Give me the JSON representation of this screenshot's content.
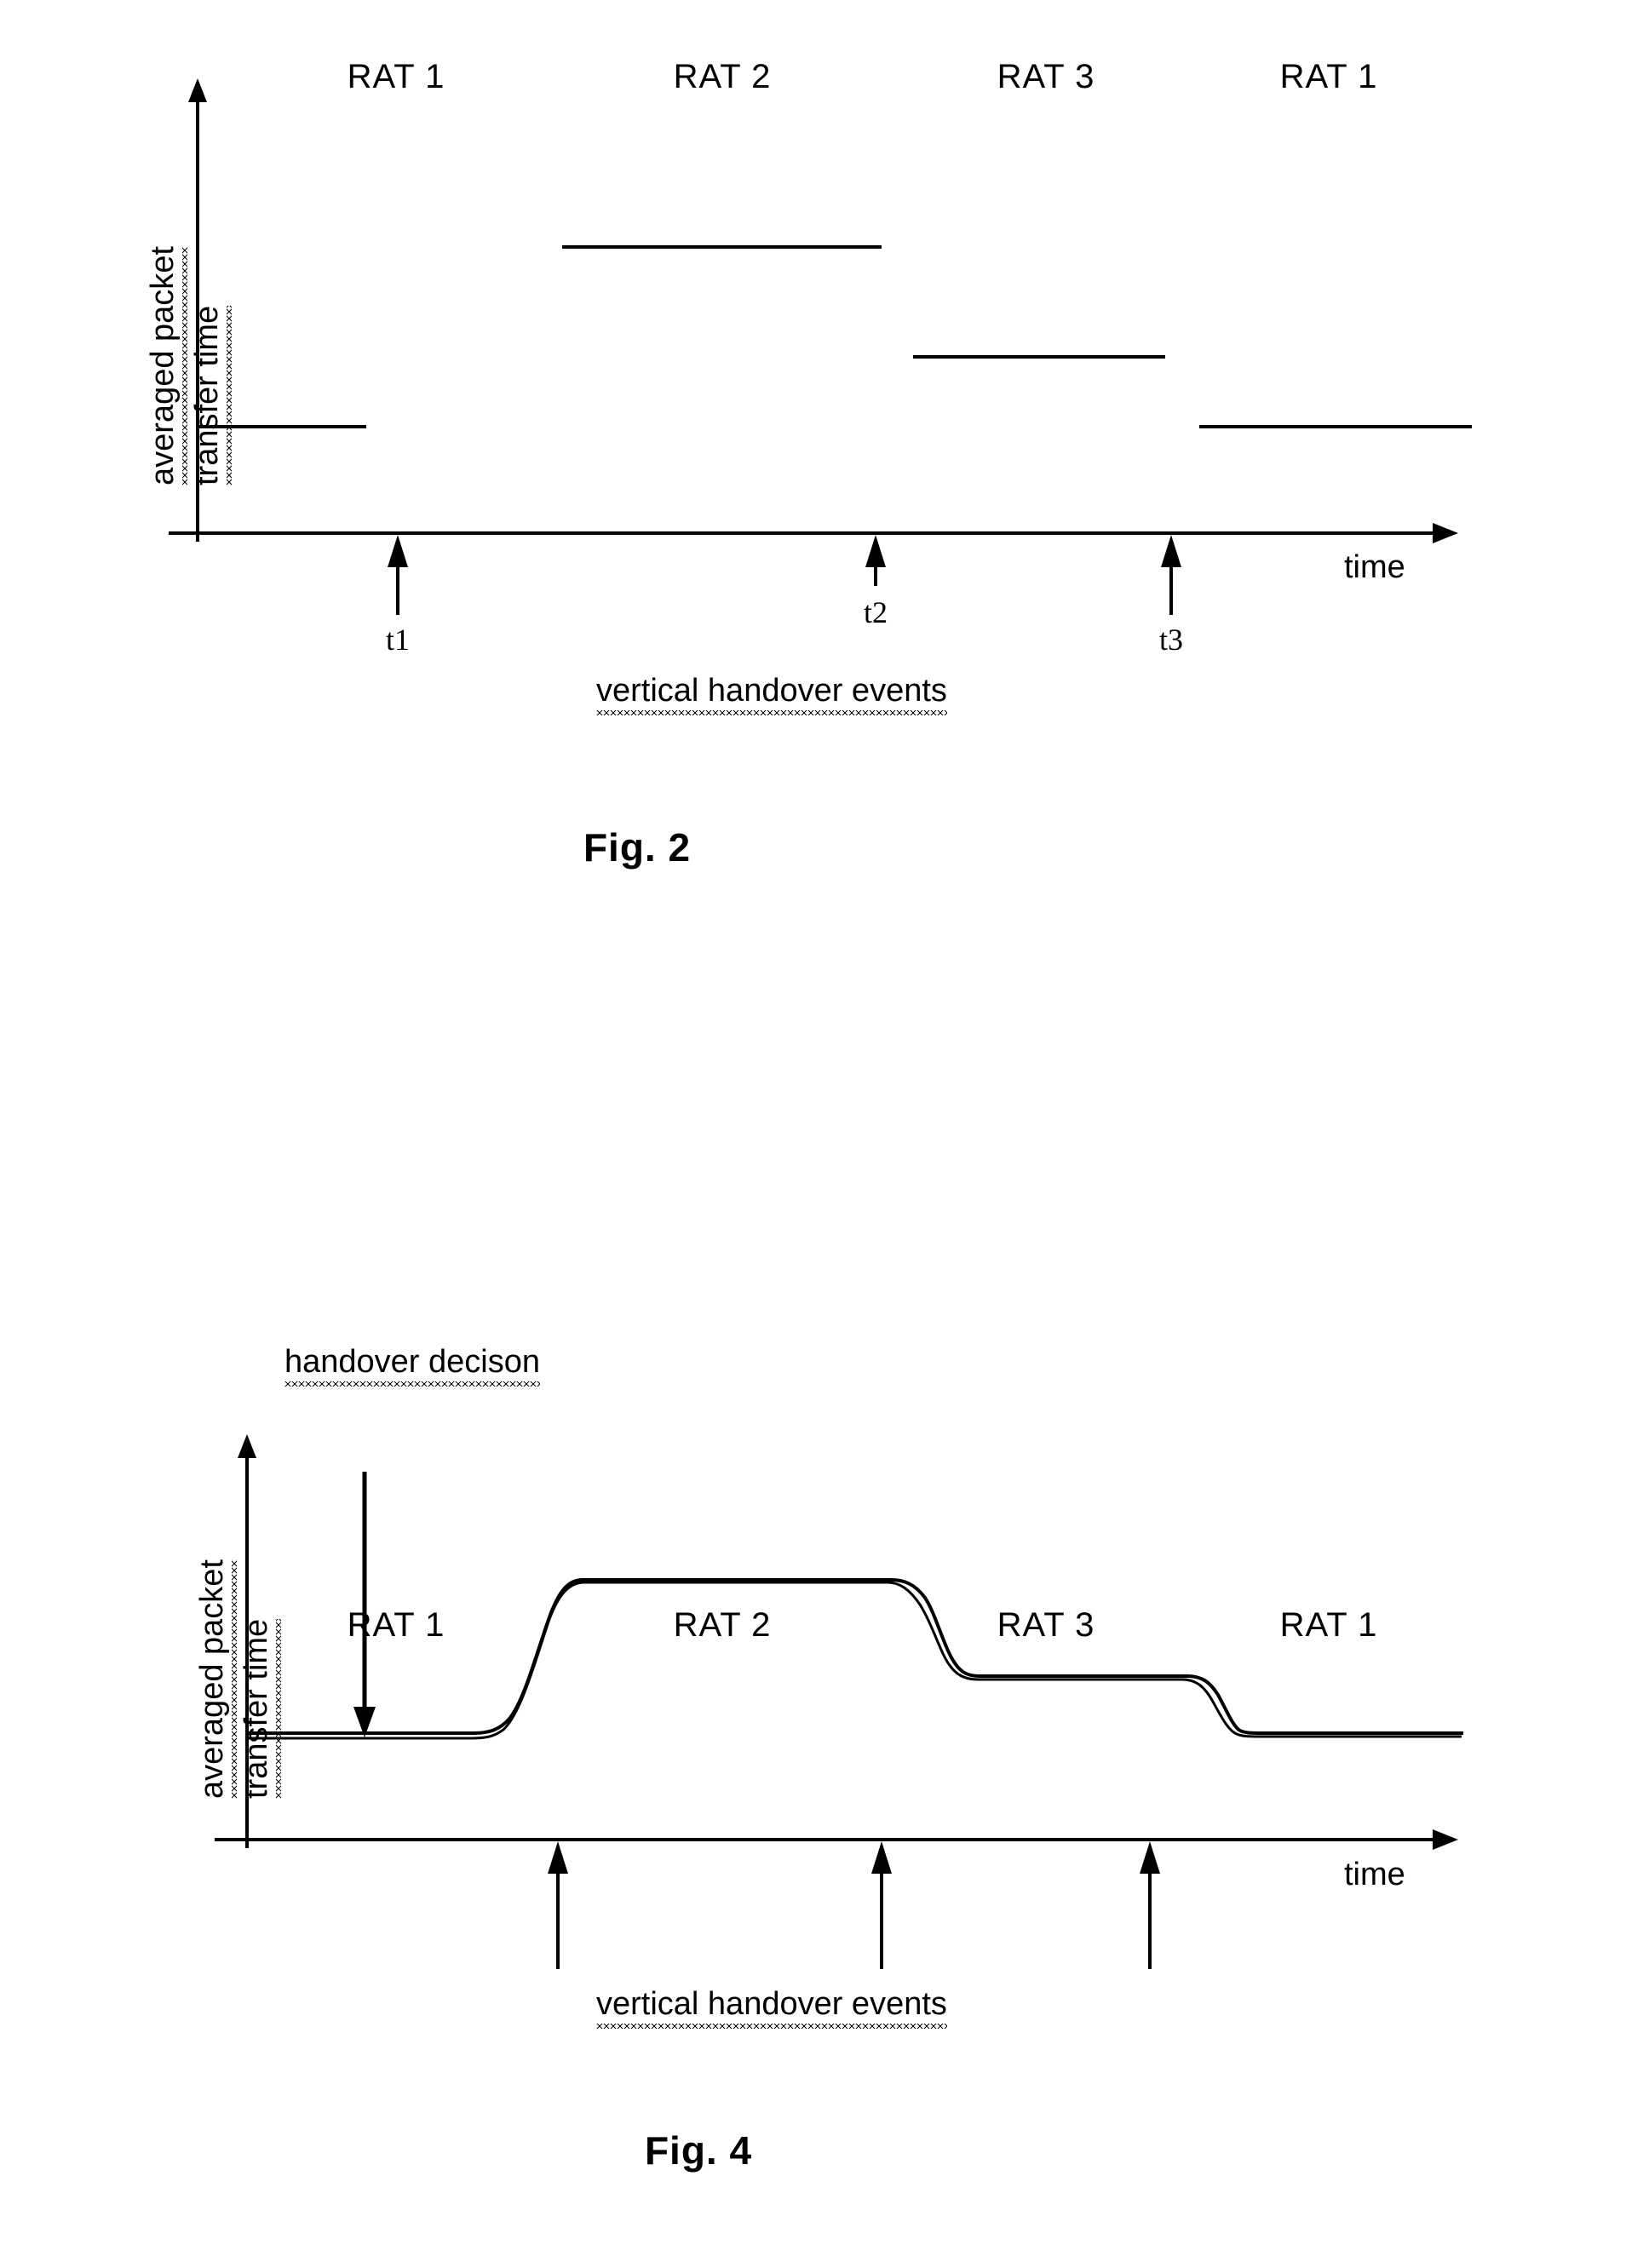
{
  "document": {
    "background_color": "#ffffff",
    "line_color": "#000000",
    "figure_count": 2
  },
  "figure2": {
    "caption": "Fig. 2",
    "y_axis_label_line1": "averaged packet",
    "y_axis_label_line2": "transfer time",
    "x_axis_label": "time",
    "events_label": "vertical handover events",
    "rat_labels": [
      "RAT 1",
      "RAT 2",
      "RAT 3",
      "RAT 1"
    ],
    "event_labels": [
      "t1",
      "t2",
      "t3"
    ],
    "chart_data": {
      "type": "line",
      "title": "Fig. 2",
      "xlabel": "time",
      "ylabel": "averaged packet transfer time",
      "grid": false,
      "legend": "none",
      "description": "Idealised step profile of averaged packet transfer time across vertical handover events between radio access technologies.",
      "segments": [
        {
          "rat": "RAT 1",
          "level": 1,
          "x_start": 0.0,
          "x_end": 0.15
        },
        {
          "rat": "RAT 2",
          "level": 3,
          "x_start": 0.3,
          "x_end": 0.55
        },
        {
          "rat": "RAT 3",
          "level": 2,
          "x_start": 0.58,
          "x_end": 0.77
        },
        {
          "rat": "RAT 1",
          "level": 1,
          "x_start": 0.8,
          "x_end": 1.0
        }
      ],
      "levels": {
        "1": "low (RAT 1)",
        "2": "medium (RAT 3)",
        "3": "high (RAT 2)"
      },
      "events": [
        {
          "label": "t1",
          "x": 0.18
        },
        {
          "label": "t2",
          "x": 0.55
        },
        {
          "label": "t3",
          "x": 0.78
        }
      ],
      "xlim": [
        0,
        1
      ],
      "ylim": [
        0,
        1
      ]
    }
  },
  "figure4": {
    "caption": "Fig. 4",
    "y_axis_label_line1": "averaged packet",
    "y_axis_label_line2": "transfer time",
    "x_axis_label": "time",
    "events_label": "vertical handover events",
    "annotation_label": "handover decison",
    "rat_labels": [
      "RAT 1",
      "RAT 2",
      "RAT 3",
      "RAT 1"
    ],
    "chart_data": {
      "type": "line",
      "title": "Fig. 4",
      "xlabel": "time",
      "ylabel": "averaged packet transfer time",
      "grid": false,
      "legend": "none",
      "description": "Smoothed (filtered) averaged packet transfer time showing gradual transitions at each vertical handover, with a handover decision marker on the first RAT 1 plateau. Two closely-spaced traces are shown.",
      "annotation": {
        "text": "handover decison",
        "arrow_x": 0.2,
        "points_to": "RAT 1 plateau"
      },
      "segments": [
        {
          "rat": "RAT 1",
          "level": 1,
          "x_start": 0.0,
          "x_end": 0.22
        },
        {
          "rat": "RAT 2",
          "level": 3,
          "x_start": 0.28,
          "x_end": 0.55
        },
        {
          "rat": "RAT 3",
          "level": 2,
          "x_start": 0.6,
          "x_end": 0.77
        },
        {
          "rat": "RAT 1",
          "level": 1,
          "x_start": 0.82,
          "x_end": 1.0
        }
      ],
      "transitions": [
        {
          "from_level": 1,
          "to_level": 3,
          "x_start": 0.22,
          "x_end": 0.28,
          "shape": "s-curve"
        },
        {
          "from_level": 3,
          "to_level": 2,
          "x_start": 0.55,
          "x_end": 0.6,
          "shape": "s-curve"
        },
        {
          "from_level": 2,
          "to_level": 1,
          "x_start": 0.77,
          "x_end": 0.82,
          "shape": "s-curve"
        }
      ],
      "events": [
        {
          "label": "",
          "x": 0.3
        },
        {
          "label": "",
          "x": 0.55
        },
        {
          "label": "",
          "x": 0.76
        }
      ],
      "xlim": [
        0,
        1
      ],
      "ylim": [
        0,
        1
      ]
    }
  }
}
